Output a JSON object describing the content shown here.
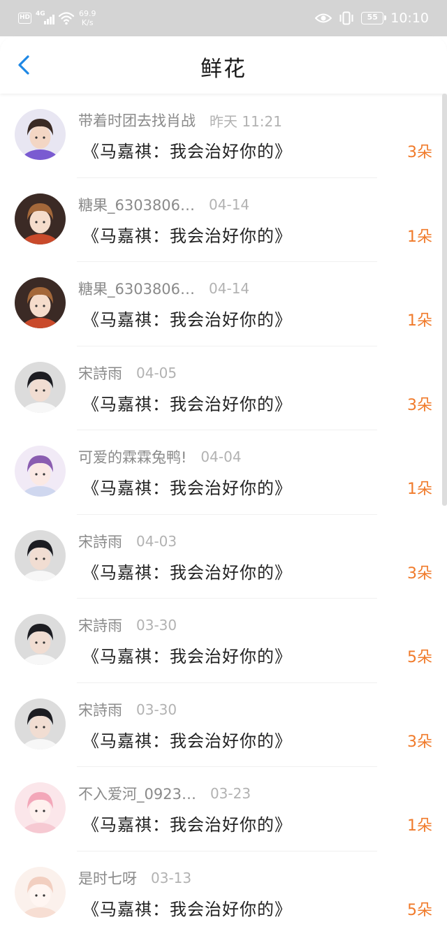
{
  "status_bar": {
    "hd": "HD",
    "network": "4G",
    "speed_value": "69.9",
    "speed_unit": "K/s",
    "battery": "55",
    "time": "10:10"
  },
  "header": {
    "title": "鲜花",
    "back_icon": "chevron-left-icon"
  },
  "colors": {
    "accent": "#1e88e5",
    "count": "#f07a2a",
    "status_bar": "#d4d4d4"
  },
  "gifts": [
    {
      "name": "带着时团去找肖战",
      "time": "昨天 11:21",
      "message": "《马嘉祺：我会治好你的》",
      "count": "3朵"
    },
    {
      "name": "糖果_6303806…",
      "time": "04-14",
      "message": "《马嘉祺：我会治好你的》",
      "count": "1朵"
    },
    {
      "name": "糖果_6303806…",
      "time": "04-14",
      "message": "《马嘉祺：我会治好你的》",
      "count": "1朵"
    },
    {
      "name": "宋詩雨",
      "time": "04-05",
      "message": "《马嘉祺：我会治好你的》",
      "count": "3朵"
    },
    {
      "name": "可爱的霖霖兔鸭!",
      "time": "04-04",
      "message": "《马嘉祺：我会治好你的》",
      "count": "1朵"
    },
    {
      "name": "宋詩雨",
      "time": "04-03",
      "message": "《马嘉祺：我会治好你的》",
      "count": "3朵"
    },
    {
      "name": "宋詩雨",
      "time": "03-30",
      "message": "《马嘉祺：我会治好你的》",
      "count": "5朵"
    },
    {
      "name": "宋詩雨",
      "time": "03-30",
      "message": "《马嘉祺：我会治好你的》",
      "count": "3朵"
    },
    {
      "name": "不入爱河_0923…",
      "time": "03-23",
      "message": "《马嘉祺：我会治好你的》",
      "count": "1朵"
    },
    {
      "name": "是时七呀",
      "time": "03-13",
      "message": "《马嘉祺：我会治好你的》",
      "count": "5朵"
    }
  ]
}
